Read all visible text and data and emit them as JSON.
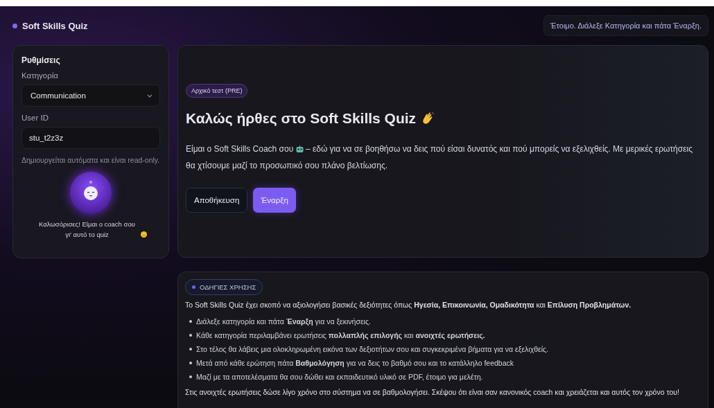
{
  "app": {
    "title": "Soft Skills Quiz"
  },
  "status": "Έτοιμο. Διάλεξε Κατηγορία και πάτα Έναρξη.",
  "settings": {
    "title": "Ρυθμίσεις",
    "category_label": "Κατηγορία",
    "category_value": "Communication",
    "user_id_label": "User ID",
    "user_id_value": "stu_t2z3z",
    "user_id_hint": "Δημιουργείται αυτόματα και είναι read-only.",
    "coach_message": "Καλωσόρισες! Είμαι ο coach σου γι' αυτό το quiz"
  },
  "welcome": {
    "badge": "Αρχικό τεστ (PRE)",
    "title": "Καλώς ήρθες στο Soft Skills Quiz",
    "intro_before": "Είμαι ο Soft Skills Coach σου",
    "intro_after": "– εδώ για να σε βοηθήσω να δεις πού είσαι δυνατός και πού μπορείς να εξελιχθείς. Με μερικές ερωτήσεις θα χτίσουμε μαζί το προσωπικό σου πλάνο βελτίωσης.",
    "buttons": [
      {
        "label": "Αποθήκευση",
        "kind": "secondary"
      },
      {
        "label": "Έναρξη",
        "kind": "primary"
      }
    ]
  },
  "instructions": {
    "badge": "ΟΔΗΓΙΕΣ ΧΡΗΣΗΣ",
    "intro": "Το Soft Skills Quiz έχει σκοπό να αξιολογήσει βασικές δεξιότητες όπως **Ηγεσία, Επικοινωνία, Ομαδικότητα** και **Επίλυση Προβλημάτων.**",
    "items": [
      "Διάλεξε κατηγορία και πάτα **Έναρξη** για να ξεκινήσεις.",
      "Κάθε κατηγορία περιλαμβάνει ερωτήσεις **πολλαπλής επιλογής** και **ανοιχτές ερωτήσεις.**",
      "Στο τέλος θα λάβεις μια ολοκληρωμένη εικόνα των δεξιοτήτων σου και συγκεκριμένα βήματα για να εξελιχθείς.",
      "Μετά από κάθε ερώτηση πάτα **Βαθμολόγηση** για να δεις το βαθμό σου και το κατάλληλο feedback",
      "Μαζί με τα αποτελέσματα θα σου δώθει και εκπαιδευτικό υλικό σε PDF, έτοιμο για μελέτη."
    ],
    "note": "Στις ανοιχτές ερωτήσεις δώσε λίγο χρόνο στο σύστημα να σε βαθμολογήσει. Σκέψου ότι είναι σαν κανονικός coach και χρειάζεται και αυτός τον χρόνο του!"
  }
}
